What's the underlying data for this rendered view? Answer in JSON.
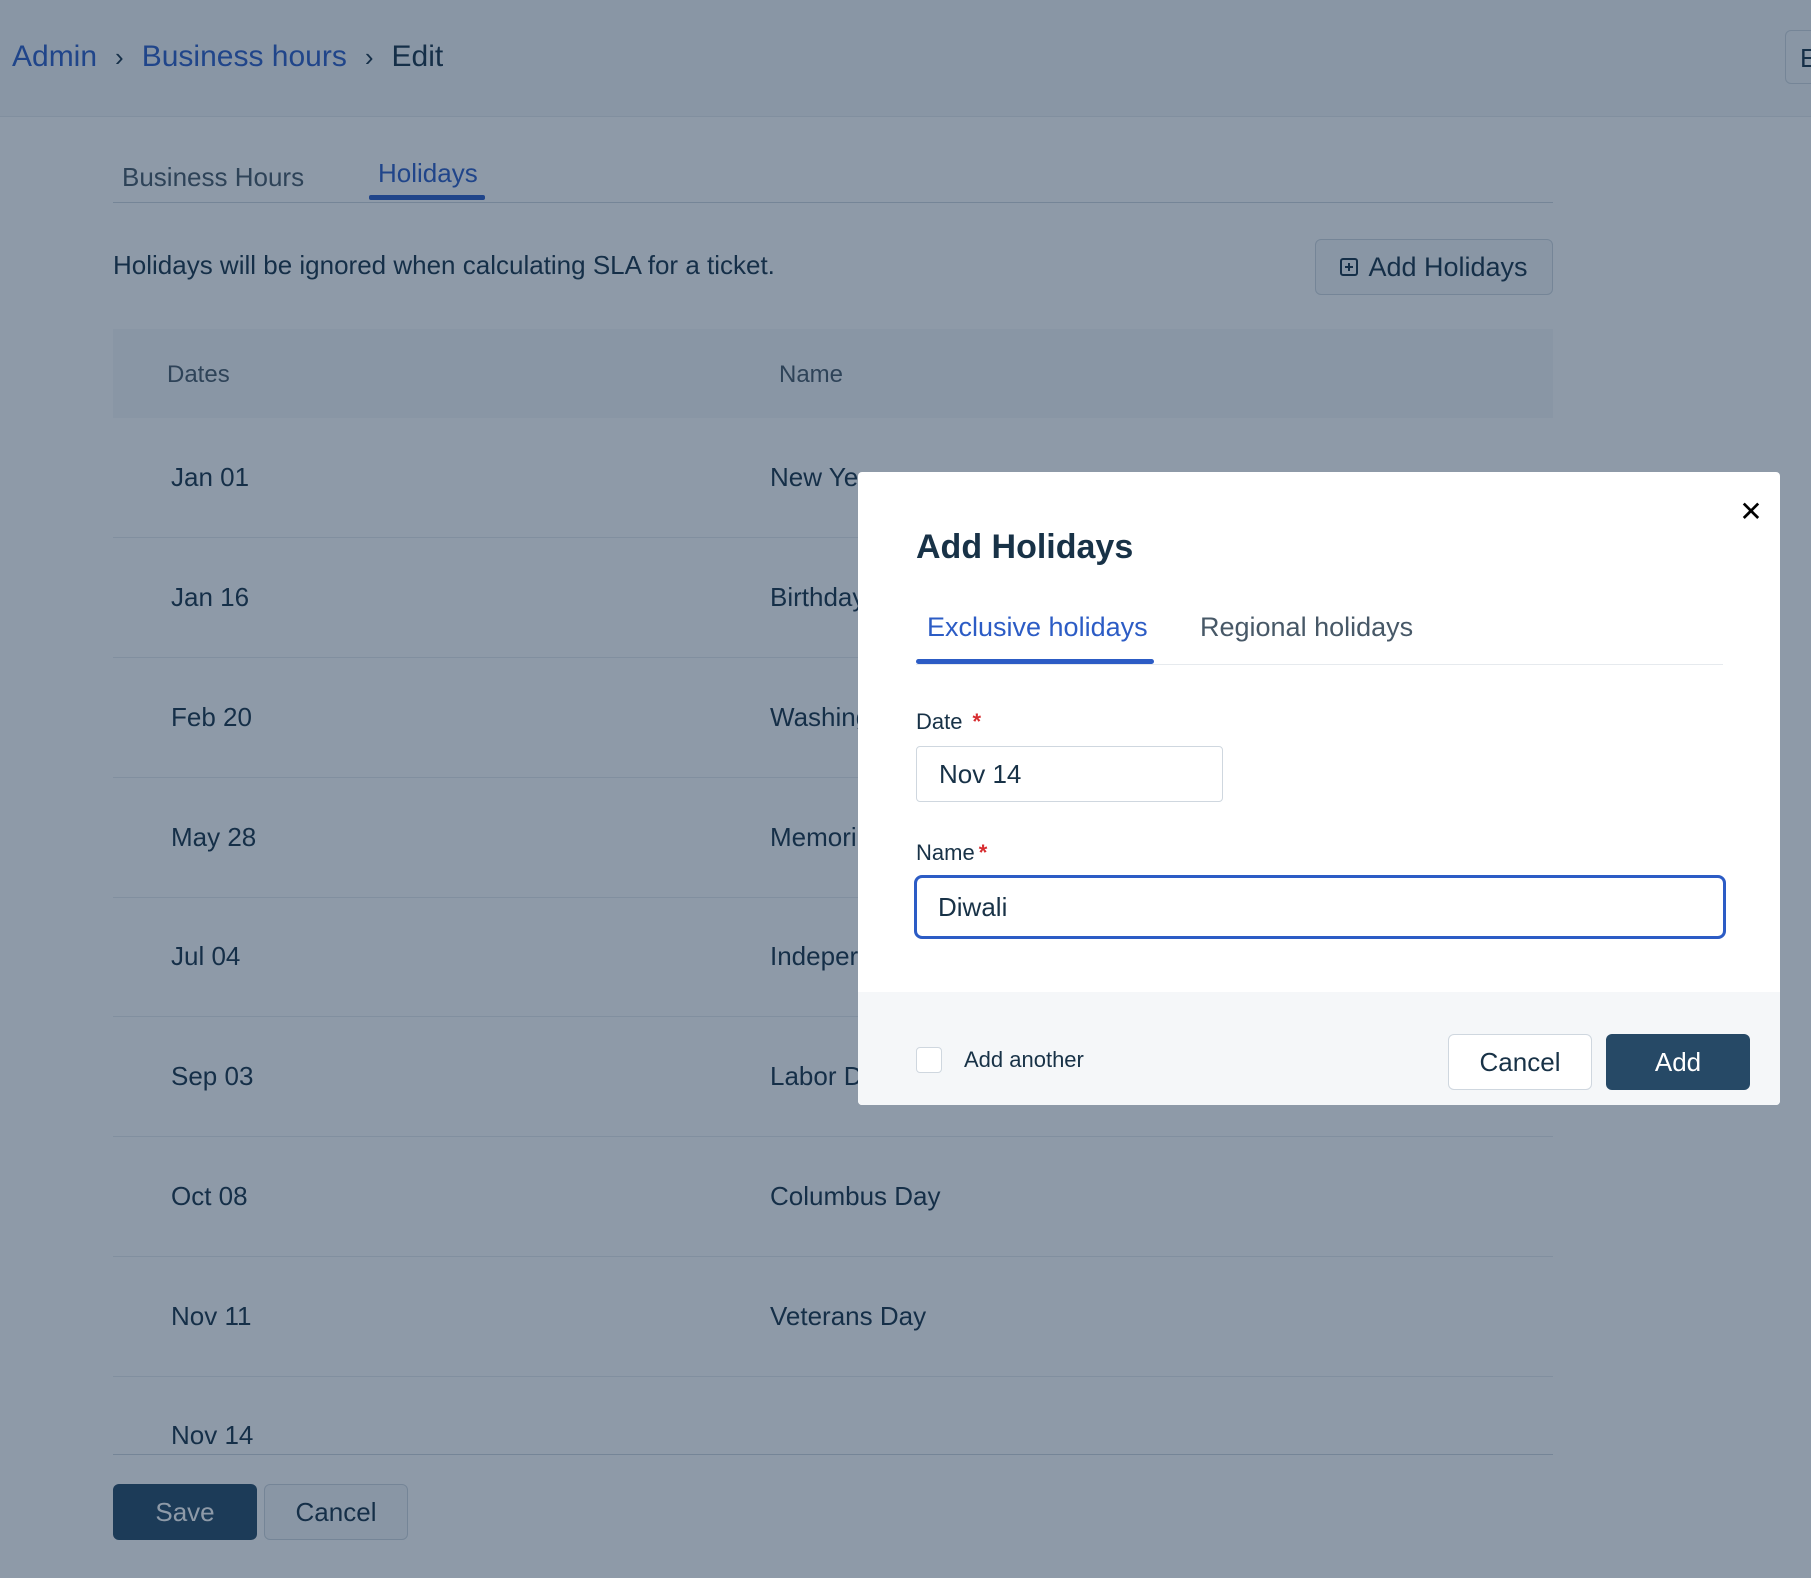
{
  "colors": {
    "accent": "#2c5cc5",
    "primary_button": "#264966",
    "required": "#d72d30",
    "overlay": "rgba(18,44,74,0.48)"
  },
  "breadcrumb": {
    "items": [
      {
        "label": "Admin"
      },
      {
        "label": "Business hours"
      },
      {
        "label": "Edit"
      }
    ],
    "separator_icon": "chevron-right-icon"
  },
  "header": {
    "right_button_label": "E"
  },
  "tabs": [
    {
      "label": "Business Hours",
      "active": false
    },
    {
      "label": "Holidays",
      "active": true
    }
  ],
  "holidays": {
    "description": "Holidays will be ignored when calculating SLA for a ticket.",
    "add_button": {
      "label": "Add Holidays",
      "icon": "plus-square-icon"
    },
    "columns": [
      "Dates",
      "Name"
    ],
    "rows": [
      {
        "date": "Jan 01",
        "name": "New Ye"
      },
      {
        "date": "Jan 16",
        "name": "Birthday"
      },
      {
        "date": "Feb 20",
        "name": "Washing"
      },
      {
        "date": "May 28",
        "name": "Memori"
      },
      {
        "date": "Jul 04",
        "name": "Indeper"
      },
      {
        "date": "Sep 03",
        "name": "Labor D"
      },
      {
        "date": "Oct 08",
        "name": "Columbus Day"
      },
      {
        "date": "Nov 11",
        "name": "Veterans Day"
      },
      {
        "date": "Nov 14",
        "name": ""
      }
    ]
  },
  "footer": {
    "save_label": "Save",
    "cancel_label": "Cancel"
  },
  "modal": {
    "title": "Add Holidays",
    "close_icon": "close-icon",
    "tabs": [
      {
        "label": "Exclusive holidays",
        "active": true
      },
      {
        "label": "Regional holidays",
        "active": false
      }
    ],
    "date_field": {
      "label": "Date",
      "required_mark": "*",
      "value": "Nov 14"
    },
    "name_field": {
      "label": "Name",
      "required_mark": "*",
      "value": "Diwali"
    },
    "add_another": {
      "label": "Add another",
      "checked": false
    },
    "cancel_label": "Cancel",
    "add_label": "Add"
  }
}
